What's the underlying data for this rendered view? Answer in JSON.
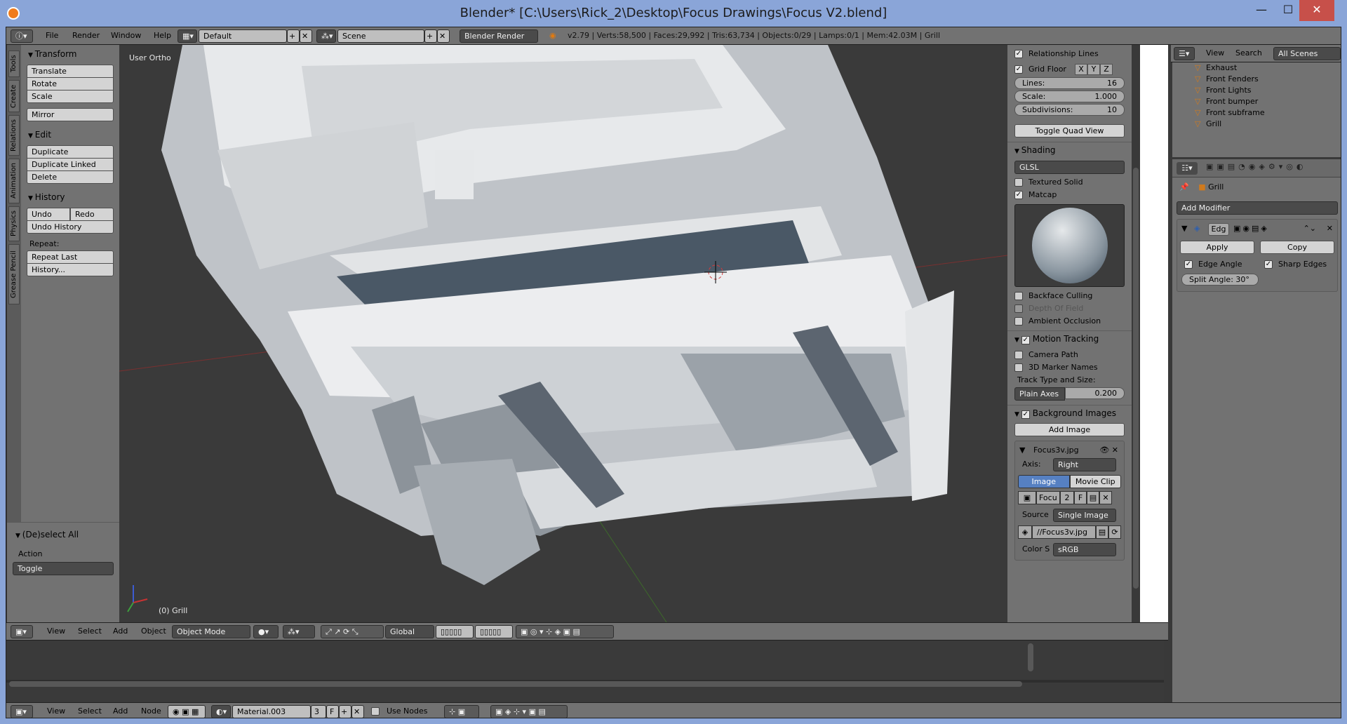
{
  "window": {
    "title": "Blender* [C:\\Users\\Rick_2\\Desktop\\Focus Drawings\\Focus V2.blend]",
    "minimize": "—",
    "maximize": "☐",
    "close": "✕"
  },
  "info_header": {
    "menus": [
      "File",
      "Render",
      "Window",
      "Help"
    ],
    "screen_layout": "Default",
    "scene": "Scene",
    "render_engine": "Blender Render",
    "stats": "v2.79 | Verts:58,500 | Faces:29,992 | Tris:63,734 | Objects:0/29 | Lamps:0/1 | Mem:42.03M | Grill"
  },
  "tool_tabs": [
    "Tools",
    "Create",
    "Relations",
    "Animation",
    "Physics",
    "Grease Pencil"
  ],
  "toolshelf": {
    "transform": {
      "title": "Transform",
      "buttons": [
        "Translate",
        "Rotate",
        "Scale"
      ],
      "mirror": "Mirror"
    },
    "edit": {
      "title": "Edit",
      "buttons": [
        "Duplicate",
        "Duplicate Linked",
        "Delete"
      ]
    },
    "history": {
      "title": "History",
      "undo": "Undo",
      "redo": "Redo",
      "undo_history": "Undo History",
      "repeat_label": "Repeat:",
      "repeat_last": "Repeat Last",
      "history_btn": "History..."
    },
    "operator": {
      "title": "(De)select All",
      "action_label": "Action",
      "action_value": "Toggle"
    }
  },
  "viewport": {
    "view_name": "User Ortho",
    "object_label": "(0) Grill"
  },
  "npanel": {
    "relationship_lines": "Relationship Lines",
    "grid_floor": "Grid Floor",
    "axes": [
      "X",
      "Y",
      "Z"
    ],
    "lines_label": "Lines:",
    "lines_value": "16",
    "scale_label": "Scale:",
    "scale_value": "1.000",
    "subdiv_label": "Subdivisions:",
    "subdiv_value": "10",
    "toggle_quad": "Toggle Quad View",
    "shading_title": "Shading",
    "shading_mode": "GLSL",
    "textured_solid": "Textured Solid",
    "matcap": "Matcap",
    "backface": "Backface Culling",
    "dof": "Depth Of Field",
    "ao": "Ambient Occlusion",
    "motion_tracking": "Motion Tracking",
    "camera_path": "Camera Path",
    "marker_names": "3D Marker Names",
    "track_type_label": "Track Type and Size:",
    "track_type": "Plain Axes",
    "track_size": "0.200",
    "bg_images": "Background Images",
    "add_image": "Add Image",
    "image_name": "Focus3v.jpg",
    "axis_label": "Axis:",
    "axis_value": "Right",
    "image_tab": "Image",
    "movie_tab": "Movie Clip",
    "img_block": "Focu",
    "img_users": "2",
    "img_f": "F",
    "source_label": "Source",
    "source_value": "Single Image",
    "filepath": "//Focus3v.jpg",
    "color_space_label": "Color S",
    "color_space": "sRGB"
  },
  "outliner": {
    "menus": [
      "View",
      "Search"
    ],
    "filter": "All Scenes",
    "items": [
      "Exhaust",
      "Front Fenders",
      "Front Lights",
      "Front bumper",
      "Front subframe",
      "Grill"
    ]
  },
  "properties": {
    "object_name": "Grill",
    "add_modifier": "Add Modifier",
    "modifier_name": "Edg",
    "apply": "Apply",
    "copy": "Copy",
    "edge_angle": "Edge Angle",
    "sharp_edges": "Sharp Edges",
    "split_angle": "Split Angle: 30°"
  },
  "view3d_header": {
    "menus": [
      "View",
      "Select",
      "Add",
      "Object"
    ],
    "mode": "Object Mode",
    "orientation": "Global"
  },
  "node_header": {
    "menus": [
      "View",
      "Select",
      "Add",
      "Node"
    ],
    "material": "Material.003",
    "users": "3",
    "f": "F",
    "use_nodes": "Use Nodes"
  }
}
